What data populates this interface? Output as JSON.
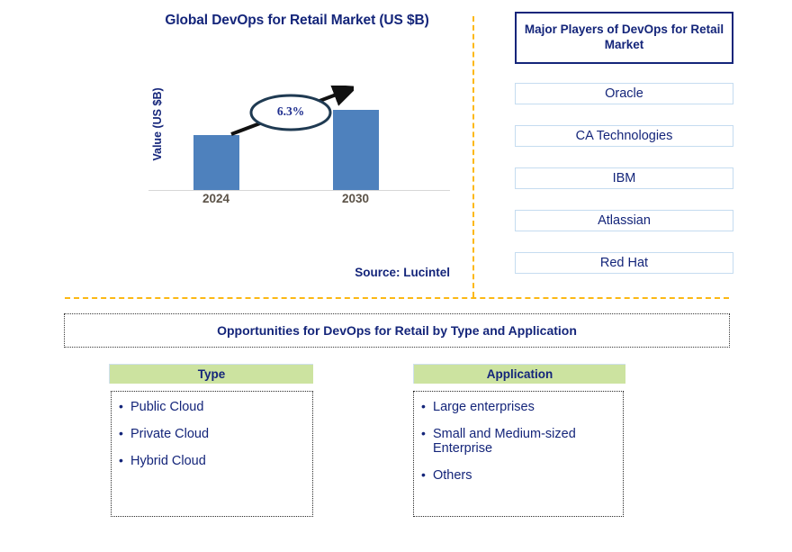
{
  "chart_data": {
    "type": "bar",
    "title": "Global DevOps for Retail Market (US $B)",
    "categories": [
      "2024",
      "2030"
    ],
    "values": [
      61,
      89
    ],
    "xlabel": "",
    "ylabel": "Value (US $B)",
    "grid": false,
    "legend": "none",
    "annotations": [
      {
        "label": "6.3%",
        "type": "cagr-callout",
        "from": "2024",
        "to": "2030"
      }
    ],
    "series": [
      {
        "name": "Value (US $B)",
        "values": [
          61,
          89
        ]
      }
    ],
    "bar_color": "#4e81bd",
    "source": "Source: Lucintel"
  },
  "chart": {
    "title": "Global DevOps for Retail Market (US $B)",
    "y_axis_title": "Value (US $B)",
    "x_ticks": [
      "2024",
      "2030"
    ],
    "cagr_label": "6.3%",
    "source": "Source: Lucintel"
  },
  "players": {
    "header": "Major Players of DevOps for Retail Market",
    "items": [
      {
        "name": "Oracle"
      },
      {
        "name": "CA Technologies"
      },
      {
        "name": "IBM"
      },
      {
        "name": "Atlassian"
      },
      {
        "name": "Red Hat"
      }
    ]
  },
  "opportunities": {
    "banner": "Opportunities for DevOps for Retail by Type and Application",
    "type": {
      "header": "Type",
      "items": [
        "Public Cloud",
        "Private Cloud",
        "Hybrid Cloud"
      ]
    },
    "application": {
      "header": "Application",
      "items": [
        "Large enterprises",
        "Small and Medium-sized Enterprise",
        "Others"
      ]
    }
  },
  "colors": {
    "navy": "#14257a",
    "bar_blue": "#4e81bd",
    "divider_orange": "#fcb814",
    "segment_green": "#cce3a0"
  }
}
